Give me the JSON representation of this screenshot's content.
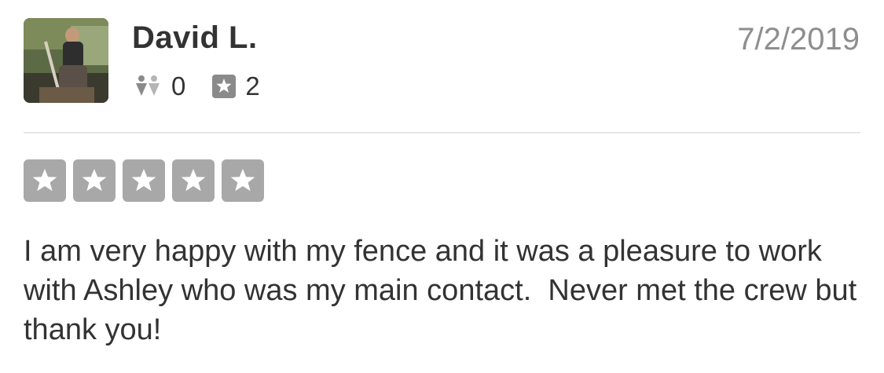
{
  "reviewer": {
    "name": "David L.",
    "avatar_icon": "user-photo-avatar",
    "friends_count": "0",
    "friends_icon": "friends-icon",
    "reviews_count": "2",
    "reviews_icon": "review-star-icon"
  },
  "review": {
    "date": "7/2/2019",
    "rating": 5,
    "rating_max": 5,
    "star_color": "#a8a8a8",
    "text": "I am very happy with my fence and it was a pleasure to work with Ashley who was my main contact.  Never met the crew but thank you!"
  }
}
